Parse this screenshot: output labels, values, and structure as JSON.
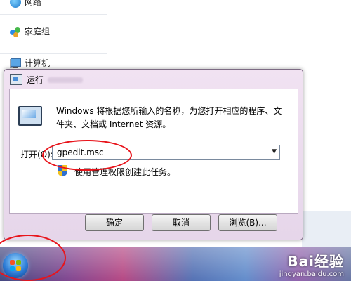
{
  "explorer": {
    "nav_items": [
      {
        "label": "网络",
        "icon": "globe-icon"
      },
      {
        "label": "家庭组",
        "icon": "homegroup-icon"
      },
      {
        "label": "计算机",
        "icon": "computer-icon"
      }
    ]
  },
  "dialog": {
    "title": "运行",
    "description": "Windows 将根据您所输入的名称，为您打开相应的程序、文件夹、文档或 Internet 资源。",
    "open_label": "打开(O):",
    "input_value": "gpedit.msc",
    "uac_note": "使用管理权限创建此任务。",
    "buttons": {
      "ok": "确定",
      "cancel": "取消",
      "browse": "浏览(B)..."
    }
  },
  "watermark": {
    "logo": "Bai经验",
    "url": "jingyan.baidu.com"
  },
  "colors": {
    "annotation": "#e8141b",
    "dialog_frame": "#f1e2f2"
  }
}
